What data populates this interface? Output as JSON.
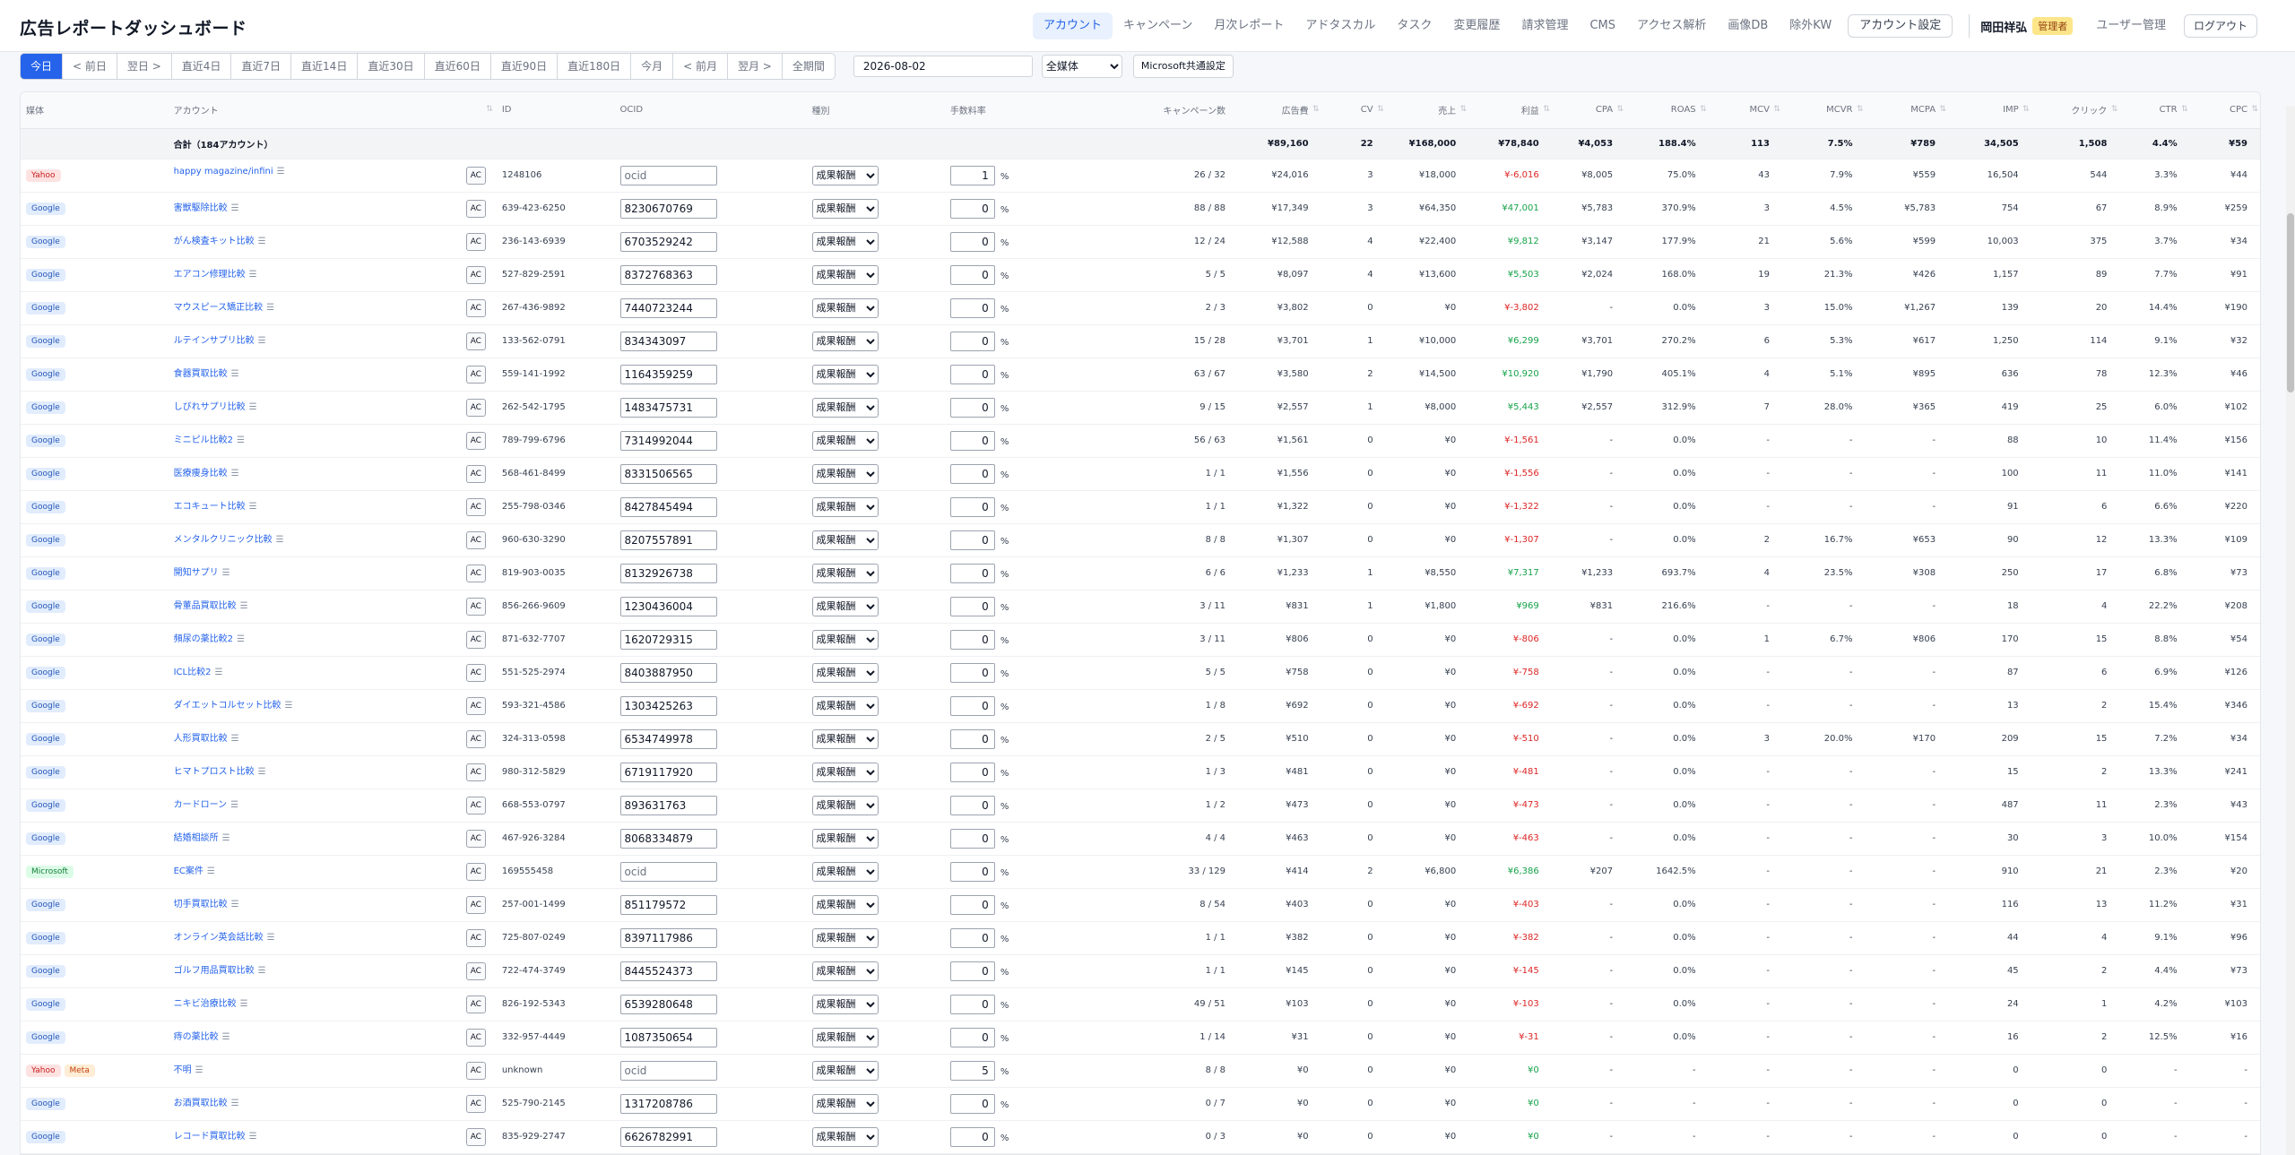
{
  "app_title": "広告レポートダッシュボード",
  "nav": {
    "items": [
      "アカウント",
      "キャンペーン",
      "月次レポート",
      "アドタスカル",
      "タスク",
      "変更履歴",
      "請求管理",
      "CMS",
      "アクセス解析",
      "画像DB",
      "除外KW"
    ],
    "active_index": 0,
    "account_settings": "アカウント設定",
    "user_name": "岡田祥弘",
    "role": "管理者",
    "user_admin": "ユーザー管理",
    "logout": "ログアウト"
  },
  "filters": {
    "periods": [
      "今日",
      "< 前日",
      "翌日 >",
      "直近4日",
      "直近7日",
      "直近14日",
      "直近30日",
      "直近60日",
      "直近90日",
      "直近180日",
      "今月",
      "< 前月",
      "翌月 >",
      "全期間"
    ],
    "active_period": 0,
    "date": "2026-08-02",
    "media_selected": "全媒体",
    "ms_settings": "Microsoft共通設定"
  },
  "table": {
    "headers": {
      "media": "媒体",
      "account": "アカウント",
      "id": "ID",
      "ocid": "OCID",
      "type": "種別",
      "fee": "手数料率",
      "campaigns": "キャンペーン数",
      "spend": "広告費",
      "cv": "CV",
      "sales": "売上",
      "profit": "利益",
      "cpa": "CPA",
      "roas": "ROAS",
      "mcv": "MCV",
      "mcvr": "MCVR",
      "mcpa": "MCPA",
      "imp": "IMP",
      "clicks": "クリック",
      "ctr": "CTR",
      "cpc": "CPC"
    },
    "total": {
      "label": "合計（184アカウント）",
      "spend": "¥89,160",
      "cv": "22",
      "sales": "¥168,000",
      "profit": "¥78,840",
      "cpa": "¥4,053",
      "roas": "188.4%",
      "mcv": "113",
      "mcvr": "7.5%",
      "mcpa": "¥789",
      "imp": "34,505",
      "clicks": "1,508",
      "ctr": "4.4%",
      "cpc": "¥59"
    },
    "ac_label": "AC",
    "ocid_placeholder": "ocid",
    "type_value": "成果報酬",
    "pct_sign": "%",
    "rows": [
      {
        "media": [
          "Yahoo"
        ],
        "account": "happy magazine/infini",
        "id": "1248106",
        "ocid": "",
        "fee": "1",
        "campaigns": "26 / 32",
        "spend": "¥24,016",
        "cv": "3",
        "sales": "¥18,000",
        "profit": "¥-6,016",
        "cpa": "¥8,005",
        "roas": "75.0%",
        "mcv": "43",
        "mcvr": "7.9%",
        "mcpa": "¥559",
        "imp": "16,504",
        "clicks": "544",
        "ctr": "3.3%",
        "cpc": "¥44"
      },
      {
        "media": [
          "Google"
        ],
        "account": "害獣駆除比較",
        "id": "639-423-6250",
        "ocid": "8230670769",
        "fee": "0",
        "campaigns": "88 / 88",
        "spend": "¥17,349",
        "cv": "3",
        "sales": "¥64,350",
        "profit": "¥47,001",
        "cpa": "¥5,783",
        "roas": "370.9%",
        "mcv": "3",
        "mcvr": "4.5%",
        "mcpa": "¥5,783",
        "imp": "754",
        "clicks": "67",
        "ctr": "8.9%",
        "cpc": "¥259"
      },
      {
        "media": [
          "Google"
        ],
        "account": "がん検査キット比較",
        "id": "236-143-6939",
        "ocid": "6703529242",
        "fee": "0",
        "campaigns": "12 / 24",
        "spend": "¥12,588",
        "cv": "4",
        "sales": "¥22,400",
        "profit": "¥9,812",
        "cpa": "¥3,147",
        "roas": "177.9%",
        "mcv": "21",
        "mcvr": "5.6%",
        "mcpa": "¥599",
        "imp": "10,003",
        "clicks": "375",
        "ctr": "3.7%",
        "cpc": "¥34"
      },
      {
        "media": [
          "Google"
        ],
        "account": "エアコン修理比較",
        "id": "527-829-2591",
        "ocid": "8372768363",
        "fee": "0",
        "campaigns": "5 / 5",
        "spend": "¥8,097",
        "cv": "4",
        "sales": "¥13,600",
        "profit": "¥5,503",
        "cpa": "¥2,024",
        "roas": "168.0%",
        "mcv": "19",
        "mcvr": "21.3%",
        "mcpa": "¥426",
        "imp": "1,157",
        "clicks": "89",
        "ctr": "7.7%",
        "cpc": "¥91"
      },
      {
        "media": [
          "Google"
        ],
        "account": "マウスピース矯正比較",
        "id": "267-436-9892",
        "ocid": "7440723244",
        "fee": "0",
        "campaigns": "2 / 3",
        "spend": "¥3,802",
        "cv": "0",
        "sales": "¥0",
        "profit": "¥-3,802",
        "cpa": "-",
        "roas": "0.0%",
        "mcv": "3",
        "mcvr": "15.0%",
        "mcpa": "¥1,267",
        "imp": "139",
        "clicks": "20",
        "ctr": "14.4%",
        "cpc": "¥190"
      },
      {
        "media": [
          "Google"
        ],
        "account": "ルテインサプリ比較",
        "id": "133-562-0791",
        "ocid": "834343097",
        "fee": "0",
        "campaigns": "15 / 28",
        "spend": "¥3,701",
        "cv": "1",
        "sales": "¥10,000",
        "profit": "¥6,299",
        "cpa": "¥3,701",
        "roas": "270.2%",
        "mcv": "6",
        "mcvr": "5.3%",
        "mcpa": "¥617",
        "imp": "1,250",
        "clicks": "114",
        "ctr": "9.1%",
        "cpc": "¥32"
      },
      {
        "media": [
          "Google"
        ],
        "account": "食器買取比較",
        "id": "559-141-1992",
        "ocid": "1164359259",
        "fee": "0",
        "campaigns": "63 / 67",
        "spend": "¥3,580",
        "cv": "2",
        "sales": "¥14,500",
        "profit": "¥10,920",
        "cpa": "¥1,790",
        "roas": "405.1%",
        "mcv": "4",
        "mcvr": "5.1%",
        "mcpa": "¥895",
        "imp": "636",
        "clicks": "78",
        "ctr": "12.3%",
        "cpc": "¥46"
      },
      {
        "media": [
          "Google"
        ],
        "account": "しびれサプリ比較",
        "id": "262-542-1795",
        "ocid": "1483475731",
        "fee": "0",
        "campaigns": "9 / 15",
        "spend": "¥2,557",
        "cv": "1",
        "sales": "¥8,000",
        "profit": "¥5,443",
        "cpa": "¥2,557",
        "roas": "312.9%",
        "mcv": "7",
        "mcvr": "28.0%",
        "mcpa": "¥365",
        "imp": "419",
        "clicks": "25",
        "ctr": "6.0%",
        "cpc": "¥102"
      },
      {
        "media": [
          "Google"
        ],
        "account": "ミニピル比較2",
        "id": "789-799-6796",
        "ocid": "7314992044",
        "fee": "0",
        "campaigns": "56 / 63",
        "spend": "¥1,561",
        "cv": "0",
        "sales": "¥0",
        "profit": "¥-1,561",
        "cpa": "-",
        "roas": "0.0%",
        "mcv": "-",
        "mcvr": "-",
        "mcpa": "-",
        "imp": "88",
        "clicks": "10",
        "ctr": "11.4%",
        "cpc": "¥156"
      },
      {
        "media": [
          "Google"
        ],
        "account": "医療痩身比較",
        "id": "568-461-8499",
        "ocid": "8331506565",
        "fee": "0",
        "campaigns": "1 / 1",
        "spend": "¥1,556",
        "cv": "0",
        "sales": "¥0",
        "profit": "¥-1,556",
        "cpa": "-",
        "roas": "0.0%",
        "mcv": "-",
        "mcvr": "-",
        "mcpa": "-",
        "imp": "100",
        "clicks": "11",
        "ctr": "11.0%",
        "cpc": "¥141"
      },
      {
        "media": [
          "Google"
        ],
        "account": "エコキュート比較",
        "id": "255-798-0346",
        "ocid": "8427845494",
        "fee": "0",
        "campaigns": "1 / 1",
        "spend": "¥1,322",
        "cv": "0",
        "sales": "¥0",
        "profit": "¥-1,322",
        "cpa": "-",
        "roas": "0.0%",
        "mcv": "-",
        "mcvr": "-",
        "mcpa": "-",
        "imp": "91",
        "clicks": "6",
        "ctr": "6.6%",
        "cpc": "¥220"
      },
      {
        "media": [
          "Google"
        ],
        "account": "メンタルクリニック比較",
        "id": "960-630-3290",
        "ocid": "8207557891",
        "fee": "0",
        "campaigns": "8 / 8",
        "spend": "¥1,307",
        "cv": "0",
        "sales": "¥0",
        "profit": "¥-1,307",
        "cpa": "-",
        "roas": "0.0%",
        "mcv": "2",
        "mcvr": "16.7%",
        "mcpa": "¥653",
        "imp": "90",
        "clicks": "12",
        "ctr": "13.3%",
        "cpc": "¥109"
      },
      {
        "media": [
          "Google"
        ],
        "account": "開知サプリ",
        "id": "819-903-0035",
        "ocid": "8132926738",
        "fee": "0",
        "campaigns": "6 / 6",
        "spend": "¥1,233",
        "cv": "1",
        "sales": "¥8,550",
        "profit": "¥7,317",
        "cpa": "¥1,233",
        "roas": "693.7%",
        "mcv": "4",
        "mcvr": "23.5%",
        "mcpa": "¥308",
        "imp": "250",
        "clicks": "17",
        "ctr": "6.8%",
        "cpc": "¥73"
      },
      {
        "media": [
          "Google"
        ],
        "account": "骨董品買取比較",
        "id": "856-266-9609",
        "ocid": "1230436004",
        "fee": "0",
        "campaigns": "3 / 11",
        "spend": "¥831",
        "cv": "1",
        "sales": "¥1,800",
        "profit": "¥969",
        "cpa": "¥831",
        "roas": "216.6%",
        "mcv": "-",
        "mcvr": "-",
        "mcpa": "-",
        "imp": "18",
        "clicks": "4",
        "ctr": "22.2%",
        "cpc": "¥208"
      },
      {
        "media": [
          "Google"
        ],
        "account": "頻尿の薬比較2",
        "id": "871-632-7707",
        "ocid": "1620729315",
        "fee": "0",
        "campaigns": "3 / 11",
        "spend": "¥806",
        "cv": "0",
        "sales": "¥0",
        "profit": "¥-806",
        "cpa": "-",
        "roas": "0.0%",
        "mcv": "1",
        "mcvr": "6.7%",
        "mcpa": "¥806",
        "imp": "170",
        "clicks": "15",
        "ctr": "8.8%",
        "cpc": "¥54"
      },
      {
        "media": [
          "Google"
        ],
        "account": "ICL比較2",
        "id": "551-525-2974",
        "ocid": "8403887950",
        "fee": "0",
        "campaigns": "5 / 5",
        "spend": "¥758",
        "cv": "0",
        "sales": "¥0",
        "profit": "¥-758",
        "cpa": "-",
        "roas": "0.0%",
        "mcv": "-",
        "mcvr": "-",
        "mcpa": "-",
        "imp": "87",
        "clicks": "6",
        "ctr": "6.9%",
        "cpc": "¥126"
      },
      {
        "media": [
          "Google"
        ],
        "account": "ダイエットコルセット比較",
        "id": "593-321-4586",
        "ocid": "1303425263",
        "fee": "0",
        "campaigns": "1 / 8",
        "spend": "¥692",
        "cv": "0",
        "sales": "¥0",
        "profit": "¥-692",
        "cpa": "-",
        "roas": "0.0%",
        "mcv": "-",
        "mcvr": "-",
        "mcpa": "-",
        "imp": "13",
        "clicks": "2",
        "ctr": "15.4%",
        "cpc": "¥346"
      },
      {
        "media": [
          "Google"
        ],
        "account": "人形買取比較",
        "id": "324-313-0598",
        "ocid": "6534749978",
        "fee": "0",
        "campaigns": "2 / 5",
        "spend": "¥510",
        "cv": "0",
        "sales": "¥0",
        "profit": "¥-510",
        "cpa": "-",
        "roas": "0.0%",
        "mcv": "3",
        "mcvr": "20.0%",
        "mcpa": "¥170",
        "imp": "209",
        "clicks": "15",
        "ctr": "7.2%",
        "cpc": "¥34"
      },
      {
        "media": [
          "Google"
        ],
        "account": "ヒマトプロスト比較",
        "id": "980-312-5829",
        "ocid": "6719117920",
        "fee": "0",
        "campaigns": "1 / 3",
        "spend": "¥481",
        "cv": "0",
        "sales": "¥0",
        "profit": "¥-481",
        "cpa": "-",
        "roas": "0.0%",
        "mcv": "-",
        "mcvr": "-",
        "mcpa": "-",
        "imp": "15",
        "clicks": "2",
        "ctr": "13.3%",
        "cpc": "¥241"
      },
      {
        "media": [
          "Google"
        ],
        "account": "カードローン",
        "id": "668-553-0797",
        "ocid": "893631763",
        "fee": "0",
        "campaigns": "1 / 2",
        "spend": "¥473",
        "cv": "0",
        "sales": "¥0",
        "profit": "¥-473",
        "cpa": "-",
        "roas": "0.0%",
        "mcv": "-",
        "mcvr": "-",
        "mcpa": "-",
        "imp": "487",
        "clicks": "11",
        "ctr": "2.3%",
        "cpc": "¥43"
      },
      {
        "media": [
          "Google"
        ],
        "account": "結婚相談所",
        "id": "467-926-3284",
        "ocid": "8068334879",
        "fee": "0",
        "campaigns": "4 / 4",
        "spend": "¥463",
        "cv": "0",
        "sales": "¥0",
        "profit": "¥-463",
        "cpa": "-",
        "roas": "0.0%",
        "mcv": "-",
        "mcvr": "-",
        "mcpa": "-",
        "imp": "30",
        "clicks": "3",
        "ctr": "10.0%",
        "cpc": "¥154"
      },
      {
        "media": [
          "Microsoft"
        ],
        "account": "EC案件",
        "id": "169555458",
        "ocid": "",
        "fee": "0",
        "campaigns": "33 / 129",
        "spend": "¥414",
        "cv": "2",
        "sales": "¥6,800",
        "profit": "¥6,386",
        "cpa": "¥207",
        "roas": "1642.5%",
        "mcv": "-",
        "mcvr": "-",
        "mcpa": "-",
        "imp": "910",
        "clicks": "21",
        "ctr": "2.3%",
        "cpc": "¥20"
      },
      {
        "media": [
          "Google"
        ],
        "account": "切手買取比較",
        "id": "257-001-1499",
        "ocid": "851179572",
        "fee": "0",
        "campaigns": "8 / 54",
        "spend": "¥403",
        "cv": "0",
        "sales": "¥0",
        "profit": "¥-403",
        "cpa": "-",
        "roas": "0.0%",
        "mcv": "-",
        "mcvr": "-",
        "mcpa": "-",
        "imp": "116",
        "clicks": "13",
        "ctr": "11.2%",
        "cpc": "¥31"
      },
      {
        "media": [
          "Google"
        ],
        "account": "オンライン英会話比較",
        "id": "725-807-0249",
        "ocid": "8397117986",
        "fee": "0",
        "campaigns": "1 / 1",
        "spend": "¥382",
        "cv": "0",
        "sales": "¥0",
        "profit": "¥-382",
        "cpa": "-",
        "roas": "0.0%",
        "mcv": "-",
        "mcvr": "-",
        "mcpa": "-",
        "imp": "44",
        "clicks": "4",
        "ctr": "9.1%",
        "cpc": "¥96"
      },
      {
        "media": [
          "Google"
        ],
        "account": "ゴルフ用品買取比較",
        "id": "722-474-3749",
        "ocid": "8445524373",
        "fee": "0",
        "campaigns": "1 / 1",
        "spend": "¥145",
        "cv": "0",
        "sales": "¥0",
        "profit": "¥-145",
        "cpa": "-",
        "roas": "0.0%",
        "mcv": "-",
        "mcvr": "-",
        "mcpa": "-",
        "imp": "45",
        "clicks": "2",
        "ctr": "4.4%",
        "cpc": "¥73"
      },
      {
        "media": [
          "Google"
        ],
        "account": "ニキビ治療比較",
        "id": "826-192-5343",
        "ocid": "6539280648",
        "fee": "0",
        "campaigns": "49 / 51",
        "spend": "¥103",
        "cv": "0",
        "sales": "¥0",
        "profit": "¥-103",
        "cpa": "-",
        "roas": "0.0%",
        "mcv": "-",
        "mcvr": "-",
        "mcpa": "-",
        "imp": "24",
        "clicks": "1",
        "ctr": "4.2%",
        "cpc": "¥103"
      },
      {
        "media": [
          "Google"
        ],
        "account": "痔の薬比較",
        "id": "332-957-4449",
        "ocid": "1087350654",
        "fee": "0",
        "campaigns": "1 / 14",
        "spend": "¥31",
        "cv": "0",
        "sales": "¥0",
        "profit": "¥-31",
        "cpa": "-",
        "roas": "0.0%",
        "mcv": "-",
        "mcvr": "-",
        "mcpa": "-",
        "imp": "16",
        "clicks": "2",
        "ctr": "12.5%",
        "cpc": "¥16"
      },
      {
        "media": [
          "Yahoo",
          "Meta"
        ],
        "account": "不明",
        "id": "unknown",
        "ocid": "",
        "fee": "5",
        "campaigns": "8 / 8",
        "spend": "¥0",
        "cv": "0",
        "sales": "¥0",
        "profit": "¥0",
        "cpa": "-",
        "roas": "-",
        "mcv": "-",
        "mcvr": "-",
        "mcpa": "-",
        "imp": "0",
        "clicks": "0",
        "ctr": "-",
        "cpc": "-"
      },
      {
        "media": [
          "Google"
        ],
        "account": "お酒買取比較",
        "id": "525-790-2145",
        "ocid": "1317208786",
        "fee": "0",
        "campaigns": "0 / 7",
        "spend": "¥0",
        "cv": "0",
        "sales": "¥0",
        "profit": "¥0",
        "cpa": "-",
        "roas": "-",
        "mcv": "-",
        "mcvr": "-",
        "mcpa": "-",
        "imp": "0",
        "clicks": "0",
        "ctr": "-",
        "cpc": "-"
      },
      {
        "media": [
          "Google"
        ],
        "account": "レコード買取比較",
        "id": "835-929-2747",
        "ocid": "6626782991",
        "fee": "0",
        "campaigns": "0 / 3",
        "spend": "¥0",
        "cv": "0",
        "sales": "¥0",
        "profit": "¥0",
        "cpa": "-",
        "roas": "-",
        "mcv": "-",
        "mcvr": "-",
        "mcpa": "-",
        "imp": "0",
        "clicks": "0",
        "ctr": "-",
        "cpc": "-"
      }
    ]
  },
  "colors": {
    "accent": "#2563eb",
    "negative": "#dc2626",
    "positive": "#16a34a"
  }
}
